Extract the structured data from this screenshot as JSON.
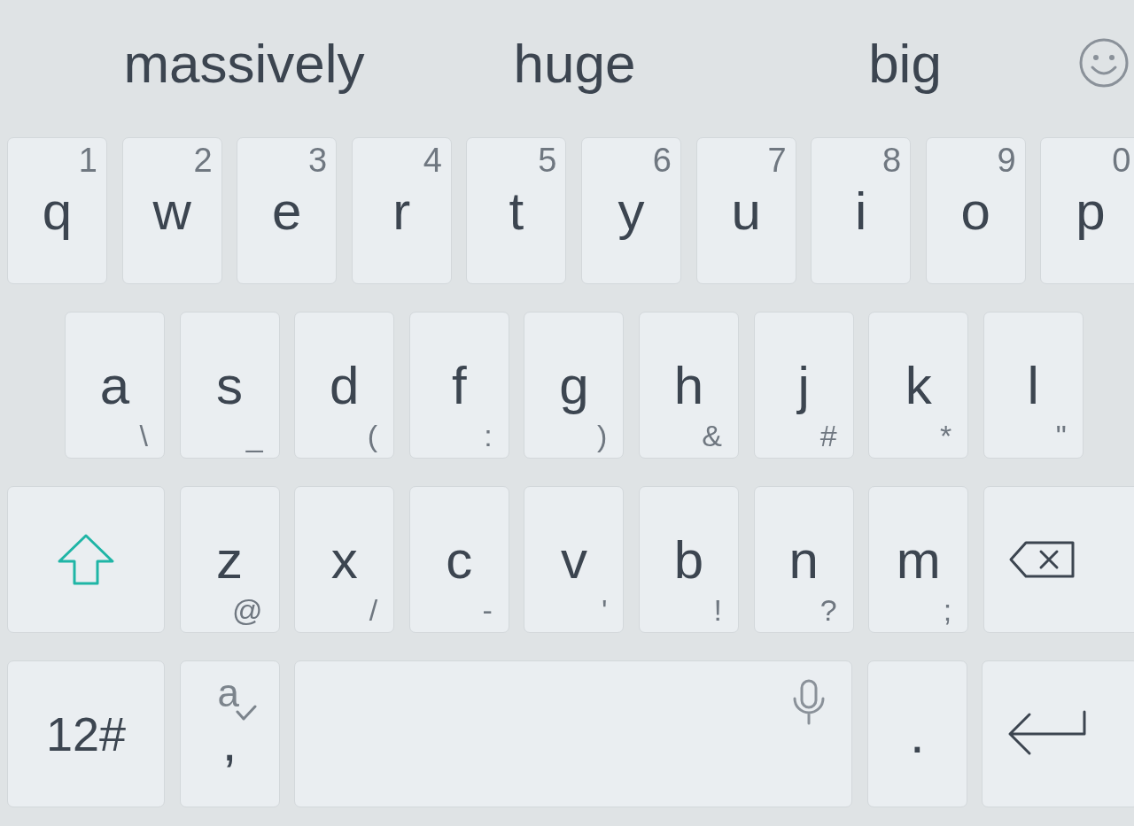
{
  "suggestions": [
    "massively",
    "huge",
    "big"
  ],
  "rows": [
    [
      {
        "kind": "letter",
        "label": "q",
        "hint": "1"
      },
      {
        "kind": "letter",
        "label": "w",
        "hint": "2"
      },
      {
        "kind": "letter",
        "label": "e",
        "hint": "3"
      },
      {
        "kind": "letter",
        "label": "r",
        "hint": "4"
      },
      {
        "kind": "letter",
        "label": "t",
        "hint": "5"
      },
      {
        "kind": "letter",
        "label": "y",
        "hint": "6"
      },
      {
        "kind": "letter",
        "label": "u",
        "hint": "7"
      },
      {
        "kind": "letter",
        "label": "i",
        "hint": "8"
      },
      {
        "kind": "letter",
        "label": "o",
        "hint": "9"
      },
      {
        "kind": "letter",
        "label": "p",
        "hint": "0"
      }
    ],
    [
      {
        "kind": "letter",
        "label": "a",
        "alt": "\\"
      },
      {
        "kind": "letter",
        "label": "s",
        "alt": "_"
      },
      {
        "kind": "letter",
        "label": "d",
        "alt": "("
      },
      {
        "kind": "letter",
        "label": "f",
        "alt": ":"
      },
      {
        "kind": "letter",
        "label": "g",
        "alt": ")"
      },
      {
        "kind": "letter",
        "label": "h",
        "alt": "&"
      },
      {
        "kind": "letter",
        "label": "j",
        "alt": "#"
      },
      {
        "kind": "letter",
        "label": "k",
        "alt": "*"
      },
      {
        "kind": "letter",
        "label": "l",
        "alt": "\""
      }
    ],
    [
      {
        "kind": "shift"
      },
      {
        "kind": "letter",
        "label": "z",
        "alt": "@"
      },
      {
        "kind": "letter",
        "label": "x",
        "alt": "/"
      },
      {
        "kind": "letter",
        "label": "c",
        "alt": "-"
      },
      {
        "kind": "letter",
        "label": "v",
        "alt": "'"
      },
      {
        "kind": "letter",
        "label": "b",
        "alt": "!"
      },
      {
        "kind": "letter",
        "label": "n",
        "alt": "?"
      },
      {
        "kind": "letter",
        "label": "m",
        "alt": ";"
      },
      {
        "kind": "backspace"
      }
    ],
    [
      {
        "kind": "symbols",
        "label": "12#"
      },
      {
        "kind": "comma",
        "label": ",",
        "top": "a"
      },
      {
        "kind": "space"
      },
      {
        "kind": "letter",
        "label": "."
      },
      {
        "kind": "enter"
      }
    ]
  ]
}
